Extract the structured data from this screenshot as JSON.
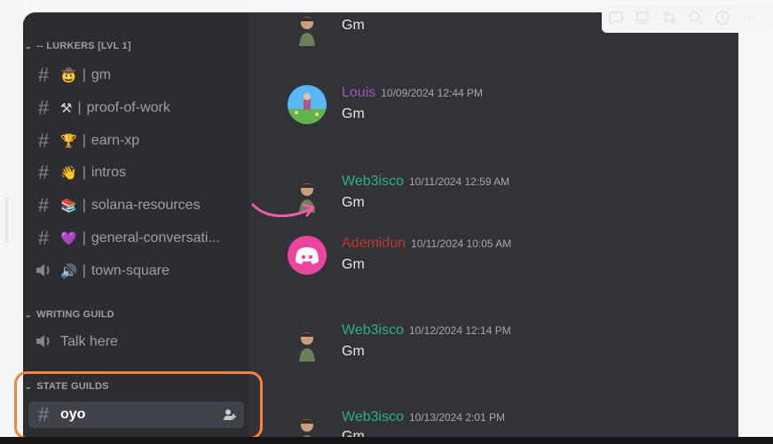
{
  "sidebar": {
    "categories": [
      {
        "label": "-- LURKERS [LVL 1]"
      },
      {
        "label": "WRITING GUILD"
      },
      {
        "label": "STATE GUILDS"
      }
    ],
    "channels": [
      {
        "type": "text",
        "emoji": "🤠",
        "name": "gm"
      },
      {
        "type": "text",
        "emoji": "⚒",
        "name": "proof-of-work"
      },
      {
        "type": "text",
        "emoji": "🏆",
        "name": "earn-xp"
      },
      {
        "type": "text",
        "emoji": "👋",
        "name": "intros"
      },
      {
        "type": "text",
        "emoji": "📚",
        "name": "solana-resources"
      },
      {
        "type": "text",
        "emoji": "💜",
        "name": "general-conversati..."
      },
      {
        "type": "voice",
        "emoji": "🔊",
        "name": "town-square"
      },
      {
        "type": "voice",
        "emoji": "",
        "name": "Talk here"
      },
      {
        "type": "text",
        "emoji": "",
        "name": "oyo",
        "active": true
      }
    ],
    "separator": "|"
  },
  "messages": [
    {
      "author": "",
      "time": "",
      "text": "Gm",
      "author_color": "#2bb08a"
    },
    {
      "author": "Louis",
      "time": "10/09/2024 12:44 PM",
      "text": "Gm",
      "author_color": "#9b59b6"
    },
    {
      "author": "Web3isco",
      "time": "10/11/2024 12:59 AM",
      "text": "Gm",
      "author_color": "#2bb08a"
    },
    {
      "author": "Ademidun",
      "time": "10/11/2024 10:05 AM",
      "text": "Gm",
      "author_color": "#c0392b"
    },
    {
      "author": "Web3isco",
      "time": "10/12/2024 12:14 PM",
      "text": "Gm",
      "author_color": "#2bb08a"
    },
    {
      "author": "Web3isco",
      "time": "10/13/2024 2:01 PM",
      "text": "Gm",
      "author_color": "#2bb08a"
    }
  ],
  "toolbar": {
    "icons": [
      "comment-icon",
      "stack-icon",
      "crop-icon",
      "zoom-icon",
      "clock-icon",
      "more-icon"
    ],
    "more_label": "⋯"
  },
  "colors": {
    "highlight_ring": "#f4853d",
    "arrow": "#f25ca6",
    "discord_default_avatar": "#eb459f"
  }
}
